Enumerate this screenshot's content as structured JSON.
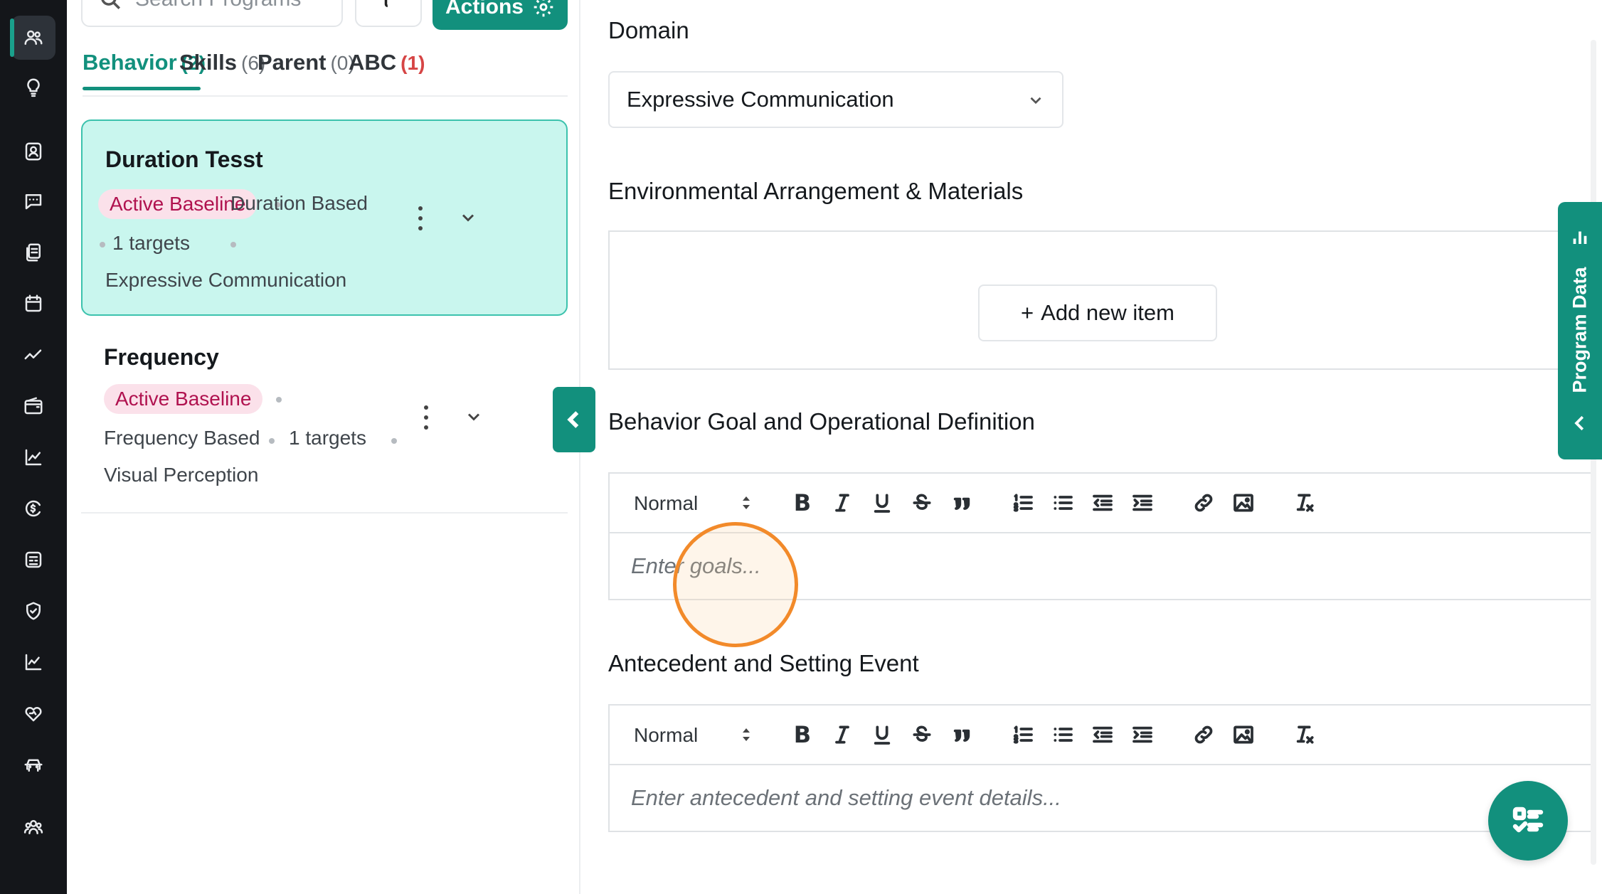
{
  "rail": {
    "items": [
      {
        "icon": "users-icon",
        "active": true
      },
      {
        "icon": "lightbulb-icon"
      },
      {
        "icon": "contact-icon"
      },
      {
        "icon": "chat-icon"
      },
      {
        "icon": "documents-icon"
      },
      {
        "icon": "calendar-icon"
      },
      {
        "icon": "trend-icon"
      },
      {
        "icon": "wallet-icon"
      },
      {
        "icon": "chart-icon"
      },
      {
        "icon": "billing-icon"
      },
      {
        "icon": "id-card-icon"
      },
      {
        "icon": "shield-check-icon"
      },
      {
        "icon": "line-chart-icon"
      },
      {
        "icon": "heart-hand-icon"
      },
      {
        "icon": "car-icon"
      },
      {
        "icon": "team-icon"
      }
    ]
  },
  "programs": {
    "search_placeholder": "Search Programs",
    "actions_label": "Actions",
    "tabs": [
      {
        "label": "Behavior",
        "count": "(2)"
      },
      {
        "label": "Skills",
        "count": "(6)"
      },
      {
        "label": "Parent",
        "count": "(0)"
      },
      {
        "label": "ABC",
        "count": "(1)"
      }
    ],
    "cards": [
      {
        "title": "Duration Tesst",
        "status": "Active Baseline",
        "type": "Duration Based",
        "targets": "1 targets",
        "domain": "Expressive Communication"
      },
      {
        "title": "Frequency",
        "status": "Active Baseline",
        "type": "Frequency Based",
        "targets": "1 targets",
        "domain": "Visual Perception"
      }
    ]
  },
  "form": {
    "domain_label": "Domain",
    "domain_value": "Expressive Communication",
    "env_label": "Environmental Arrangement & Materials",
    "add_item_label": "Add new item",
    "goal_label": "Behavior Goal and Operational Definition",
    "goal_format": "Normal",
    "goal_placeholder": "Enter goals...",
    "antecedent_label": "Antecedent and Setting Event",
    "antecedent_format": "Normal",
    "antecedent_placeholder": "Enter antecedent and setting event details..."
  },
  "side_tab": {
    "label": "Program Data"
  },
  "colors": {
    "accent": "#12907d",
    "selected_card": "#c9f6ee",
    "pill_bg": "#fbe1ea",
    "pill_text": "#b0124f",
    "rail": "#14161a",
    "click_marker": "#f28a2a"
  }
}
